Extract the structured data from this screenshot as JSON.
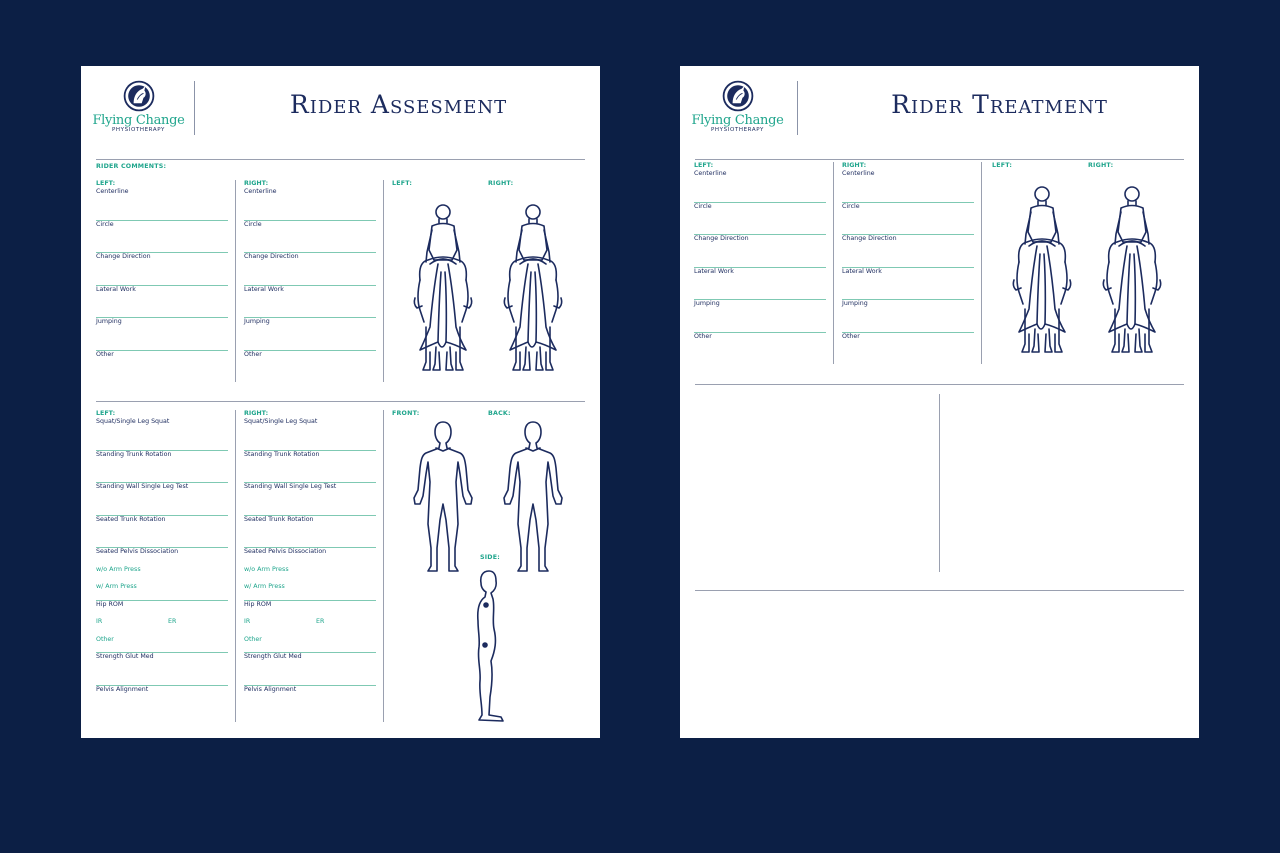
{
  "brand": {
    "name": "Flying Change",
    "tagline": "PHYSIOTHERAPY"
  },
  "assessment": {
    "title": "Rider Assesment",
    "comments_label": "RIDER COMMENTS:",
    "top": {
      "left_label": "LEFT:",
      "right_label": "RIGHT:",
      "items": [
        "Centerline",
        "Circle",
        "Change Direction",
        "Lateral Work",
        "Jumping",
        "Other"
      ],
      "figure_left_label": "LEFT:",
      "figure_right_label": "RIGHT:"
    },
    "bottom": {
      "left_label": "LEFT:",
      "right_label": "RIGHT:",
      "items": [
        "Squat/Single Leg Squat",
        "Standing Trunk Rotation",
        "Standing Wall Single Leg Test",
        "Seated Trunk Rotation",
        "Seated Pelvis Dissociation"
      ],
      "arm_options": [
        "w/o Arm Press",
        "w/ Arm Press"
      ],
      "hip_rom": "Hip ROM",
      "ir": "IR",
      "er": "ER",
      "other": "Other",
      "strength": "Strength Glut Med",
      "pelvis": "Pelvis Alignment",
      "front_label": "FRONT:",
      "back_label": "BACK:",
      "side_label": "SIDE:"
    }
  },
  "treatment": {
    "title": "Rider Treatment",
    "left_label": "LEFT:",
    "right_label": "RIGHT:",
    "items": [
      "Centerline",
      "Circle",
      "Change Direction",
      "Lateral Work",
      "Jumping",
      "Other"
    ],
    "figure_left_label": "LEFT:",
    "figure_right_label": "RIGHT:"
  },
  "colors": {
    "background": "#0c1f45",
    "navy": "#1c2b5e",
    "teal": "#1fa58c"
  }
}
